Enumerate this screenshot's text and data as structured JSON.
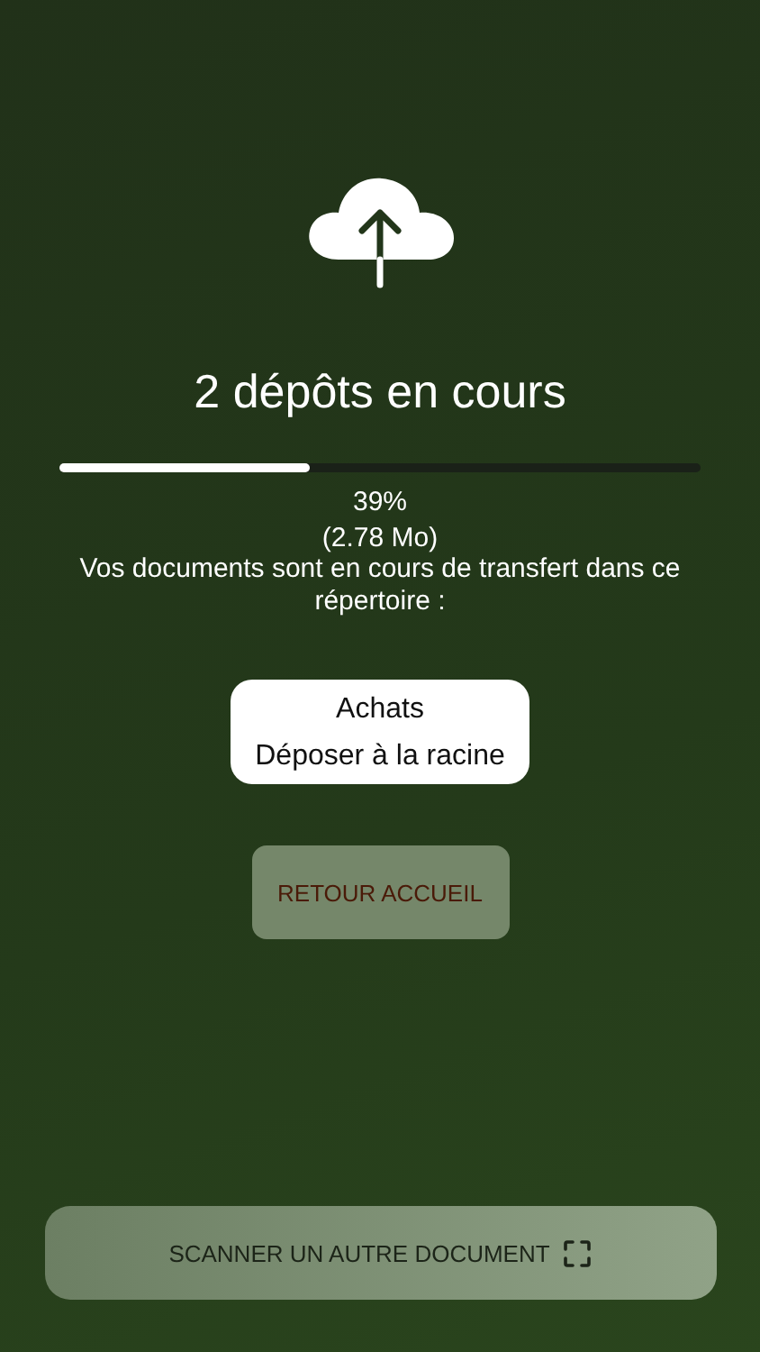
{
  "title": "2 dépôts en cours",
  "progress": {
    "level": 0.39,
    "percent": "39%",
    "size": "(2.78 Mo)"
  },
  "message": "Vos documents sont en cours de transfert dans ce répertoire :",
  "folder": {
    "name": "Achats",
    "action": "Déposer à la racine"
  },
  "home_button": {
    "label": "RETOUR ACCUEIL",
    "disabled": true
  },
  "scan_button": {
    "label": "SCANNER UN AUTRE DOCUMENT"
  }
}
